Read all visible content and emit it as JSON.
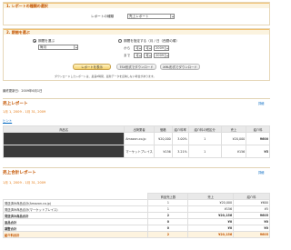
{
  "step1": {
    "title": "1. レポートの種類の選択",
    "report_type_label": "レポートの種類",
    "report_type_value": "売上レポート"
  },
  "step2": {
    "title": "2. 期間を選ぶ",
    "option_period_label": "期間を選ぶ",
    "option_period_value": "毎月",
    "option_range_label": "期間を指定する（月 / 日（西暦の順）",
    "from_label": "から",
    "to_label": "まで",
    "from_month": "1",
    "from_day": "1",
    "from_year": "2009",
    "to_month": "1",
    "to_day": "31",
    "to_year": "2009",
    "btn_view": "レポートを表示",
    "btn_tsv": "TSV形式でダウンロード",
    "btn_xml": "XML形式でダウンロード",
    "note": "ダウンロードしたレポートは、最長8時間、最新データを反映しない場合があります。"
  },
  "last_updated": "最終更新日：2009年6月1日",
  "sales_report": {
    "title": "売上レポート",
    "help_link": "詳細",
    "period": "1月 1, 2009 - 1月 31, 2009",
    "link": "ヒント",
    "columns": [
      "商品名",
      "出荷業者",
      "価格",
      "紹介料率",
      "紹介料の税区分",
      "売上",
      "紹介料"
    ],
    "rows": [
      {
        "merchant": "Amazon.co.jp",
        "price": "¥20,000",
        "rate": "3.00%",
        "qty": "1",
        "sales": "¥20,000",
        "fee": "¥600"
      },
      {
        "merchant": "マーケットプレイス",
        "price": "¥156",
        "rate": "3.21%",
        "qty": "1",
        "sales": "¥156",
        "fee": "¥5"
      }
    ]
  },
  "total_report": {
    "title": "売上合計レポート",
    "help_link": "詳細",
    "period": "1月 1, 2009 - 1月 31, 2009",
    "columns": [
      "",
      "商品売上数",
      "売上",
      "紹介料"
    ],
    "rows": [
      {
        "label": "発送済み商品合計(Amazon.co.jp)",
        "count": "1",
        "sales": "¥20,000",
        "fee": "¥600",
        "bold": false
      },
      {
        "label": "発送済み商品合計(マーケットプレイス)",
        "count": "1",
        "sales": "¥156",
        "fee": "¥5",
        "bold": false
      },
      {
        "label": "発送済み商品合計",
        "count": "2",
        "sales": "¥20,156",
        "fee": "¥605",
        "bold": true
      },
      {
        "label": "返品合計",
        "count": "0",
        "sales": "¥0",
        "fee": "¥0",
        "bold": true
      },
      {
        "label": "調整合計",
        "count": "0",
        "sales": "¥0",
        "fee": "¥0",
        "bold": true
      }
    ],
    "total": {
      "label": "紹介料合計",
      "count": "2",
      "sales": "¥20,156",
      "fee": "¥605"
    }
  },
  "colors": {
    "accent": "#c45500",
    "link": "#0066c0",
    "button": "#f3cf6a"
  }
}
